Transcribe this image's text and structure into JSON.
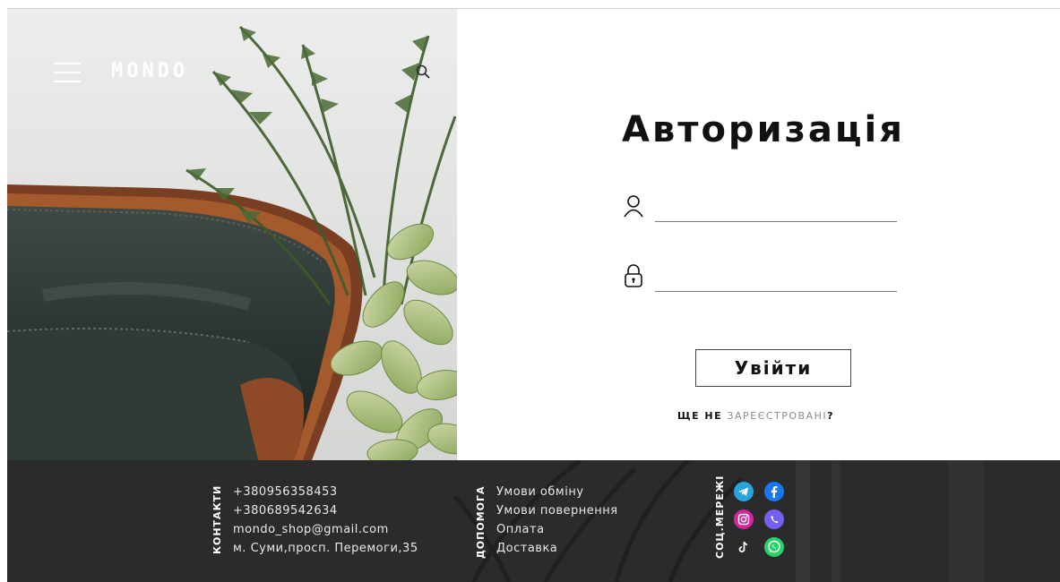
{
  "header": {
    "logo": "MONDO",
    "menu_icon": "hamburger-menu-icon",
    "search_icon": "search-icon"
  },
  "auth": {
    "title": "Авторизація",
    "username": {
      "value": "",
      "icon": "user-icon"
    },
    "password": {
      "value": "",
      "icon": "lock-icon"
    },
    "login_button": "Увійти",
    "register_prefix": "ЩЕ НЕ ",
    "register_link": "ЗАРЕЄСТРОВАНІ",
    "register_suffix": "?"
  },
  "footer": {
    "contacts": {
      "label": "КОНТАКТИ",
      "items": [
        "+380956358453",
        "+380689542634",
        "mondo_shop@gmail.com",
        "м. Суми,просп. Перемоги,35"
      ]
    },
    "help": {
      "label": "ДОПОМОГА",
      "items": [
        "Умови обміну",
        "Умови повернення",
        "Оплата",
        "Доставка"
      ]
    },
    "social": {
      "label": "СОЦ.МЕРЕЖІ",
      "icons": [
        "telegram-icon",
        "facebook-icon",
        "instagram-icon",
        "viber-icon",
        "tiktok-icon",
        "whatsapp-icon"
      ]
    }
  },
  "colors": {
    "footer_bg": "#2b2b2b",
    "telegram": "#2aa3dc",
    "facebook": "#1877f2",
    "instagram": "#d6249f",
    "viber": "#7360f2",
    "whatsapp": "#25d366",
    "link_muted": "#8a8a96"
  }
}
